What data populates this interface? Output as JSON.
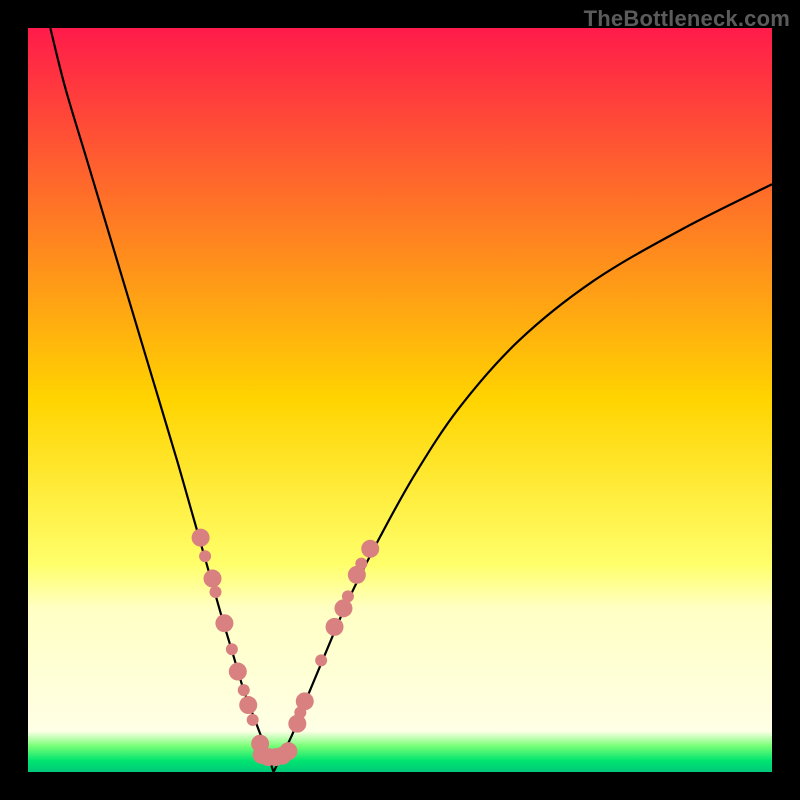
{
  "watermark": {
    "text": "TheBottleneck.com"
  },
  "chart_data": {
    "type": "line",
    "title": "",
    "xlabel": "",
    "ylabel": "",
    "xlim": [
      0,
      100
    ],
    "ylim": [
      0,
      100
    ],
    "grid": false,
    "legend": false,
    "background_gradient": {
      "stops": [
        {
          "pos": 0.0,
          "color": "#ff1b4a"
        },
        {
          "pos": 0.5,
          "color": "#ffd400"
        },
        {
          "pos": 0.72,
          "color": "#ffff6a"
        },
        {
          "pos": 0.78,
          "color": "#ffffc4"
        },
        {
          "pos": 0.945,
          "color": "#ffffe6"
        },
        {
          "pos": 0.965,
          "color": "#77ff77"
        },
        {
          "pos": 0.985,
          "color": "#00e470"
        },
        {
          "pos": 1.0,
          "color": "#00c87a"
        }
      ]
    },
    "series": [
      {
        "name": "left-branch",
        "x": [
          3,
          5,
          8,
          11,
          14,
          17,
          20,
          22,
          24,
          26,
          27.5,
          29,
          30.5,
          32,
          33
        ],
        "y": [
          100,
          92,
          82,
          72,
          62,
          52,
          42,
          35,
          28,
          21,
          16,
          11,
          7,
          3,
          0
        ]
      },
      {
        "name": "right-branch",
        "x": [
          33,
          34,
          35.5,
          37.5,
          40,
          43,
          47,
          52,
          58,
          66,
          76,
          88,
          100
        ],
        "y": [
          0,
          2,
          5,
          10,
          16,
          23,
          31,
          40,
          49,
          58,
          66,
          73,
          79
        ]
      }
    ],
    "markers": {
      "name": "highlight-dots",
      "color": "#d98080",
      "radius_major": 9,
      "radius_minor": 6,
      "points": [
        {
          "x": 23.2,
          "y": 31.5,
          "r": 9
        },
        {
          "x": 23.8,
          "y": 29.0,
          "r": 6
        },
        {
          "x": 24.8,
          "y": 26.0,
          "r": 9
        },
        {
          "x": 25.2,
          "y": 24.2,
          "r": 6
        },
        {
          "x": 26.4,
          "y": 20.0,
          "r": 9
        },
        {
          "x": 27.4,
          "y": 16.5,
          "r": 6
        },
        {
          "x": 28.2,
          "y": 13.5,
          "r": 9
        },
        {
          "x": 29.0,
          "y": 11.0,
          "r": 6
        },
        {
          "x": 29.6,
          "y": 9.0,
          "r": 9
        },
        {
          "x": 30.2,
          "y": 7.0,
          "r": 6
        },
        {
          "x": 31.2,
          "y": 3.8,
          "r": 9
        },
        {
          "x": 31.4,
          "y": 2.3,
          "r": 9
        },
        {
          "x": 32.3,
          "y": 2.0,
          "r": 9
        },
        {
          "x": 33.3,
          "y": 2.0,
          "r": 9
        },
        {
          "x": 34.2,
          "y": 2.2,
          "r": 9
        },
        {
          "x": 35.0,
          "y": 2.8,
          "r": 9
        },
        {
          "x": 36.2,
          "y": 6.5,
          "r": 9
        },
        {
          "x": 36.6,
          "y": 8.0,
          "r": 6
        },
        {
          "x": 37.2,
          "y": 9.5,
          "r": 9
        },
        {
          "x": 39.4,
          "y": 15.0,
          "r": 6
        },
        {
          "x": 41.2,
          "y": 19.5,
          "r": 9
        },
        {
          "x": 42.4,
          "y": 22.0,
          "r": 9
        },
        {
          "x": 43.0,
          "y": 23.6,
          "r": 6
        },
        {
          "x": 44.2,
          "y": 26.5,
          "r": 9
        },
        {
          "x": 44.8,
          "y": 28.0,
          "r": 6
        },
        {
          "x": 46.0,
          "y": 30.0,
          "r": 9
        }
      ]
    }
  }
}
